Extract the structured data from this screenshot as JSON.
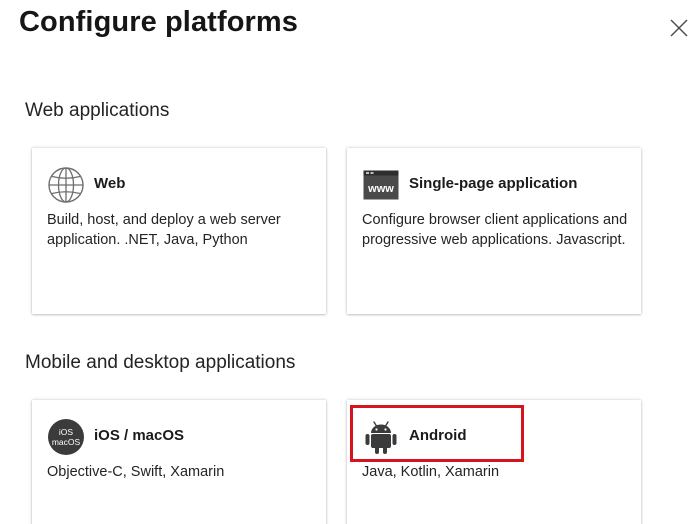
{
  "panel": {
    "title": "Configure platforms",
    "close_icon": "close-icon"
  },
  "sections": {
    "web_applications": {
      "title": "Web applications",
      "cards": {
        "web": {
          "name": "Web",
          "description": "Build, host, and deploy a web server application. .NET, Java, Python",
          "icon": "globe-icon"
        },
        "spa": {
          "name": "Single-page application",
          "description": "Configure browser client applications and progressive web applications. Javascript.",
          "icon": "www-browser-icon",
          "icon_text": "www"
        }
      }
    },
    "mobile_desktop": {
      "title": "Mobile and desktop applications",
      "cards": {
        "ios": {
          "name": "iOS / macOS",
          "description": "Objective-C, Swift, Xamarin",
          "icon": "ios-macos-icon",
          "icon_text_top": "iOS",
          "icon_text_bottom": "macOS"
        },
        "android": {
          "name": "Android",
          "description": "Java, Kotlin, Xamarin",
          "icon": "android-icon"
        }
      }
    }
  },
  "annotation": {
    "highlight_color": "#d6141e",
    "highlight_target": "Android"
  }
}
